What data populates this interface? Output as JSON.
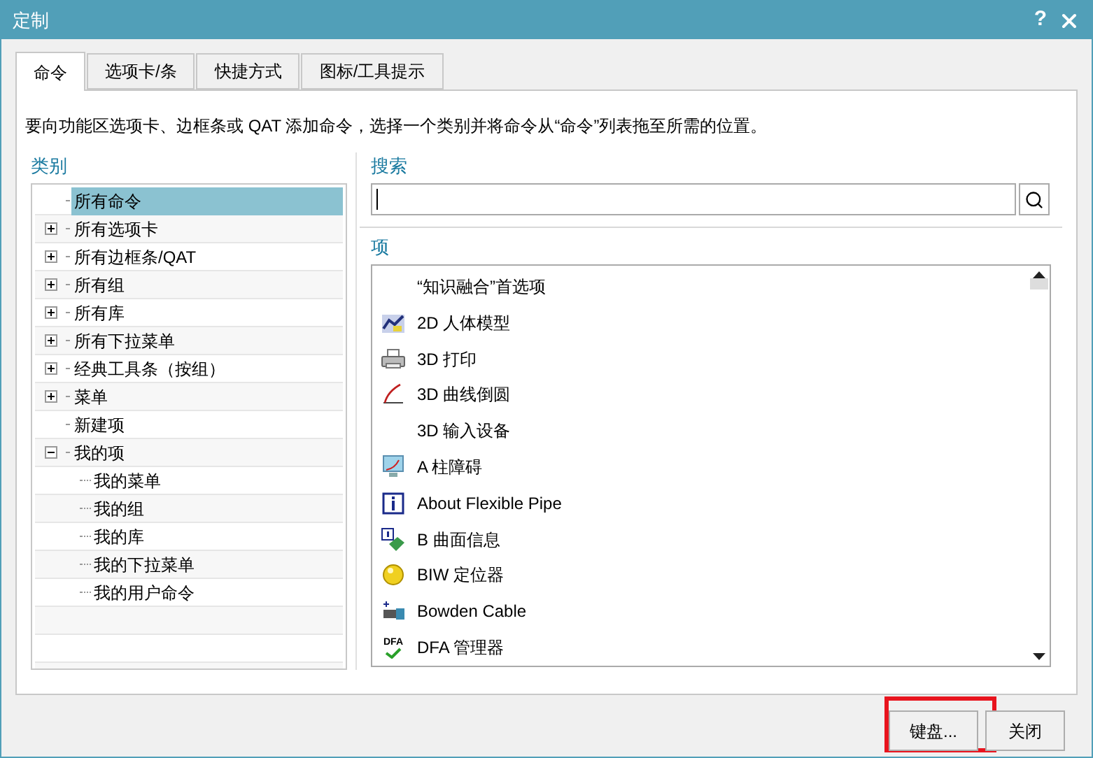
{
  "window": {
    "title": "定制",
    "help": "?"
  },
  "tabs": [
    {
      "label": "命令",
      "selected": true
    },
    {
      "label": "选项卡/条",
      "selected": false
    },
    {
      "label": "快捷方式",
      "selected": false
    },
    {
      "label": "图标/工具提示",
      "selected": false
    }
  ],
  "instruction": "要向功能区选项卡、边框条或 QAT 添加命令，选择一个类别并将命令从“命令”列表拖至所需的位置。",
  "categories": {
    "label": "类别",
    "items": [
      {
        "label": "所有命令",
        "kind": "leaf",
        "selected": true
      },
      {
        "label": "所有选项卡",
        "kind": "branch",
        "expanded": false,
        "selected": false
      },
      {
        "label": "所有边框条/QAT",
        "kind": "branch",
        "expanded": false,
        "selected": false
      },
      {
        "label": "所有组",
        "kind": "branch",
        "expanded": false,
        "selected": false
      },
      {
        "label": "所有库",
        "kind": "branch",
        "expanded": false,
        "selected": false
      },
      {
        "label": "所有下拉菜单",
        "kind": "branch",
        "expanded": false,
        "selected": false
      },
      {
        "label": "经典工具条（按组）",
        "kind": "branch",
        "expanded": false,
        "selected": false
      },
      {
        "label": "菜单",
        "kind": "branch",
        "expanded": false,
        "selected": false
      },
      {
        "label": "新建项",
        "kind": "leaf",
        "selected": false
      },
      {
        "label": "我的项",
        "kind": "branch",
        "expanded": true,
        "selected": false,
        "children": [
          {
            "label": "我的菜单",
            "selected": false
          },
          {
            "label": "我的组",
            "selected": false
          },
          {
            "label": "我的库",
            "selected": false
          },
          {
            "label": "我的下拉菜单",
            "selected": false
          },
          {
            "label": "我的用户命令",
            "selected": false
          }
        ]
      }
    ]
  },
  "search": {
    "label": "搜索"
  },
  "items": {
    "label": "项",
    "rows": [
      {
        "label": "“知识融合”首选项"
      },
      {
        "label": "2D 人体模型"
      },
      {
        "label": "3D 打印"
      },
      {
        "label": "3D 曲线倒圆"
      },
      {
        "label": "3D 输入设备"
      },
      {
        "label": "A 柱障碍"
      },
      {
        "label": "About Flexible Pipe"
      },
      {
        "label": "B 曲面信息"
      },
      {
        "label": "BIW 定位器"
      },
      {
        "label": "Bowden Cable"
      },
      {
        "label": "DFA 管理器",
        "icon_text": "DFA"
      }
    ]
  },
  "buttons": [
    {
      "label": "键盘...",
      "highlighted": true
    },
    {
      "label": "关闭",
      "highlighted": false
    }
  ]
}
